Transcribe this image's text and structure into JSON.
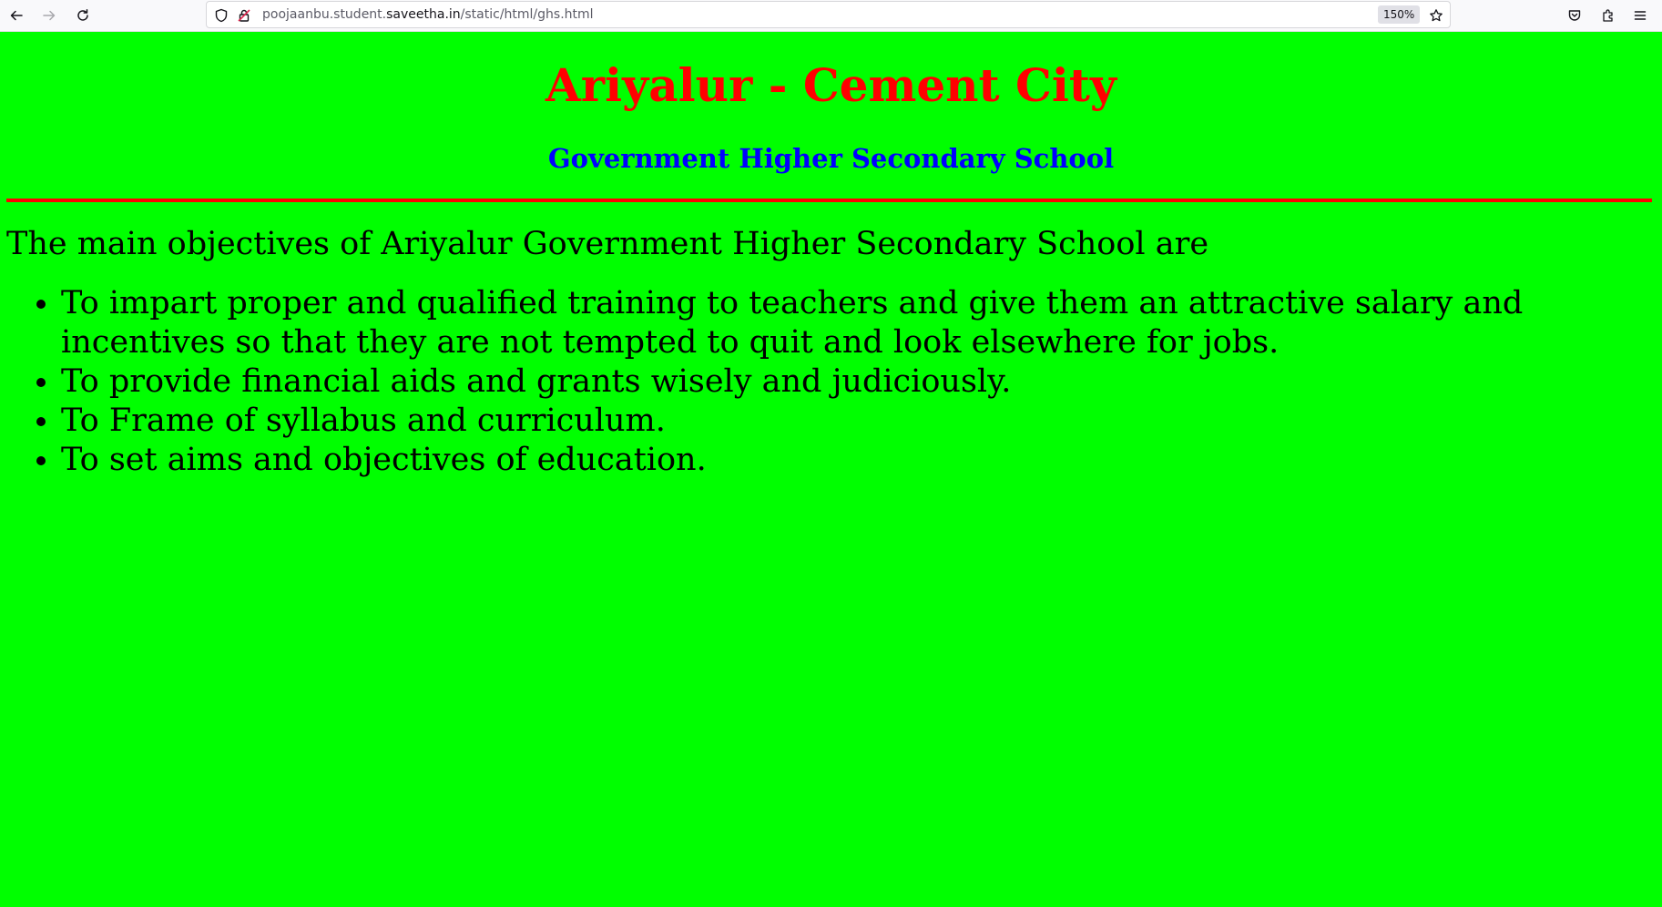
{
  "browser": {
    "url_prefix": "poojaanbu.student.",
    "url_domain": "saveetha.in",
    "url_path": "/static/html/ghs.html",
    "zoom": "150%",
    "icons": {
      "back": "back-arrow-icon",
      "forward": "forward-arrow-icon",
      "reload": "reload-icon",
      "tracking_protection": "shield-icon",
      "connection": "lock-icon",
      "bookmark": "star-icon",
      "pocket": "pocket-icon",
      "extensions": "extensions-icon",
      "menu": "hamburger-menu-icon"
    }
  },
  "page": {
    "background_color": "#00ff00",
    "title": "Ariyalur - Cement City",
    "title_color": "#ff0000",
    "subtitle": "Government Higher Secondary School",
    "subtitle_color": "#0000ff",
    "rule_color": "#ff0000",
    "intro": "The main objectives of Ariyalur Government Higher Secondary School are",
    "objectives": [
      "To impart proper and qualified training to teachers and give them an attractive salary and incentives so that they are not tempted to quit and look elsewhere for jobs.",
      "To provide financial aids and grants wisely and judiciously.",
      "To Frame of syllabus and curriculum.",
      "To set aims and objectives of education."
    ]
  }
}
